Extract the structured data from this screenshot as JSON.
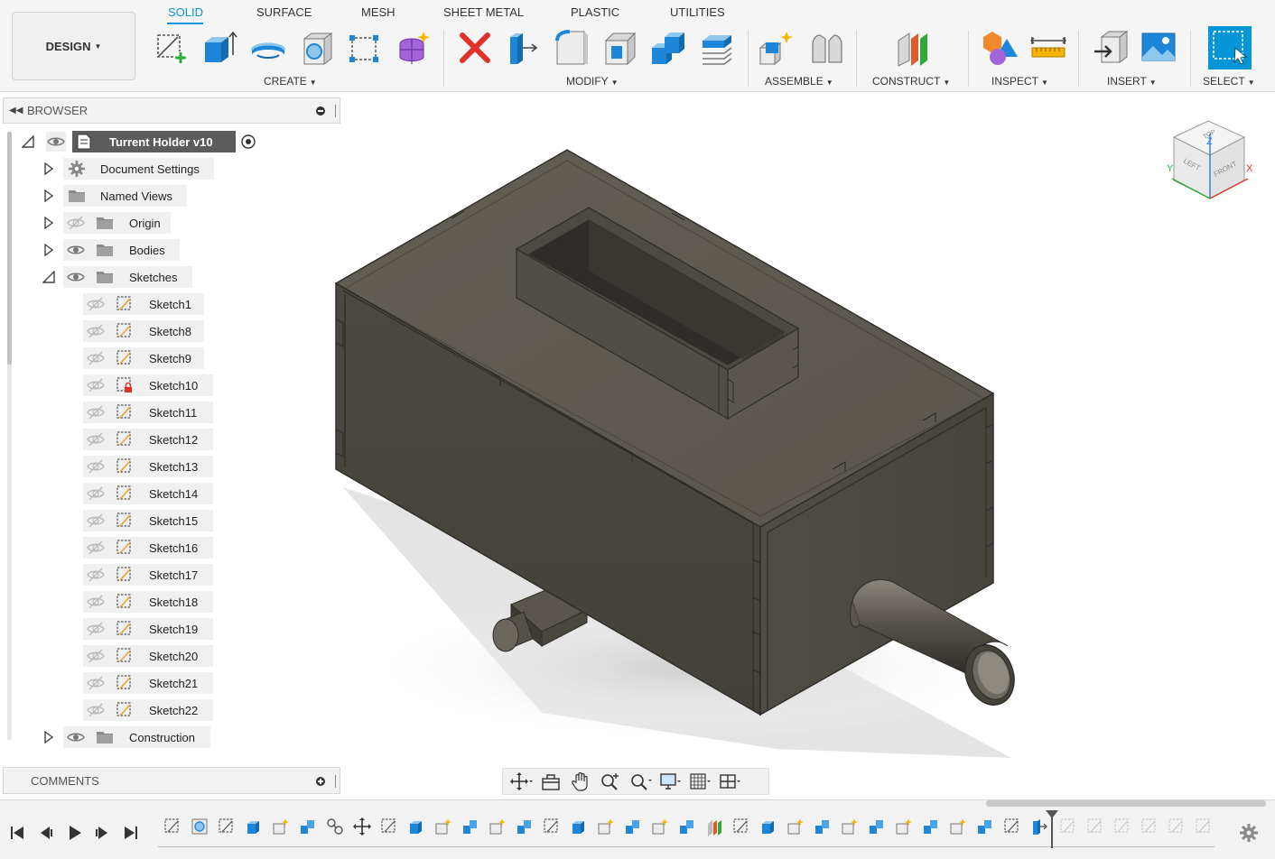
{
  "workspace": {
    "label": "DESIGN"
  },
  "tabs": [
    {
      "label": "SOLID",
      "active": true
    },
    {
      "label": "SURFACE"
    },
    {
      "label": "MESH"
    },
    {
      "label": "SHEET METAL"
    },
    {
      "label": "PLASTIC"
    },
    {
      "label": "UTILITIES"
    }
  ],
  "groups": {
    "create": "CREATE",
    "modify": "MODIFY",
    "assemble": "ASSEMBLE",
    "construct": "CONSTRUCT",
    "inspect": "INSPECT",
    "insert": "INSERT",
    "select": "SELECT"
  },
  "browser": {
    "title": "BROWSER",
    "root": "Turrent Holder v10",
    "items": [
      {
        "label": "Document Settings",
        "icon": "gear-icon"
      },
      {
        "label": "Named Views",
        "icon": "folder-icon"
      },
      {
        "label": "Origin",
        "icon": "folder-icon",
        "visible": false
      },
      {
        "label": "Bodies",
        "icon": "folder-icon",
        "visible": true
      },
      {
        "label": "Sketches",
        "icon": "folder-icon",
        "visible": true,
        "expanded": true
      },
      {
        "label": "Construction",
        "icon": "folder-icon",
        "visible": true
      }
    ],
    "sketches": [
      "Sketch1",
      "Sketch8",
      "Sketch9",
      "Sketch10",
      "Sketch11",
      "Sketch12",
      "Sketch13",
      "Sketch14",
      "Sketch15",
      "Sketch16",
      "Sketch17",
      "Sketch18",
      "Sketch19",
      "Sketch20",
      "Sketch21",
      "Sketch22"
    ]
  },
  "comments": {
    "title": "COMMENTS"
  },
  "viewcube": {
    "top": "TOP",
    "left": "LEFT",
    "front": "FRONT",
    "axis_x": "X",
    "axis_y": "Y",
    "axis_z": "Z"
  },
  "colors": {
    "accent": "#0696d7",
    "body": "#4f4b44",
    "body_top": "#5f5b53",
    "error": "#e0302a"
  }
}
